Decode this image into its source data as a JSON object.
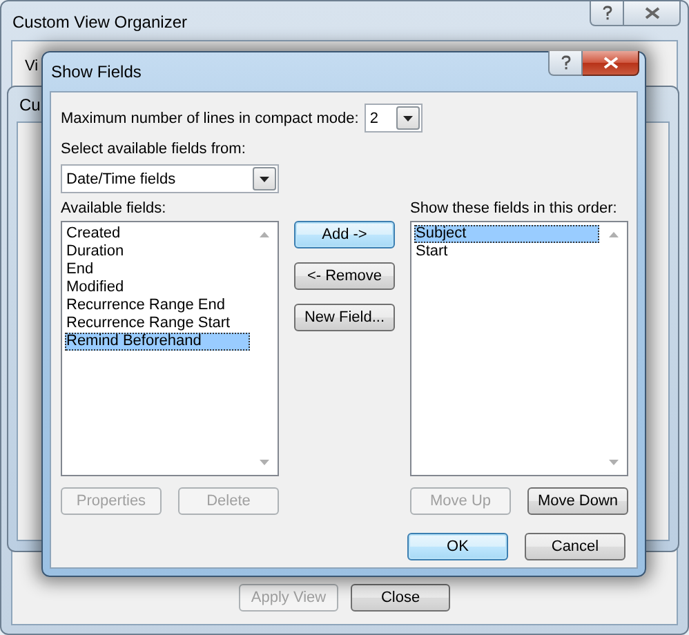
{
  "background_window": {
    "title": "Custom View Organizer",
    "tab_fragment": "Vi",
    "buttons": [
      {
        "label": "Apply View",
        "disabled": true
      },
      {
        "label": "Close",
        "disabled": false
      }
    ]
  },
  "middle_window": {
    "title_fragment": "Cu"
  },
  "dialog": {
    "title": "Show Fields",
    "max_lines": {
      "label": "Maximum number of lines in compact mode:",
      "value": "2"
    },
    "source": {
      "label": "Select available fields from:",
      "value": "Date/Time fields"
    },
    "available": {
      "label": "Available fields:",
      "items": [
        {
          "text": "Created",
          "selected": false
        },
        {
          "text": "Duration",
          "selected": false
        },
        {
          "text": "End",
          "selected": false
        },
        {
          "text": "Modified",
          "selected": false
        },
        {
          "text": "Recurrence Range End",
          "selected": false
        },
        {
          "text": "Recurrence Range Start",
          "selected": false
        },
        {
          "text": "Remind Beforehand",
          "selected": true
        }
      ]
    },
    "shown": {
      "label": "Show these fields in this order:",
      "items": [
        {
          "text": "Subject",
          "selected": true
        },
        {
          "text": "Start",
          "selected": false
        }
      ]
    },
    "middle_buttons": [
      {
        "label": "Add ->",
        "default": true,
        "disabled": false
      },
      {
        "label": "<- Remove",
        "default": false,
        "disabled": false
      },
      {
        "label": "New Field...",
        "default": false,
        "disabled": false
      }
    ],
    "available_buttons": [
      {
        "label": "Properties",
        "default": false,
        "disabled": true
      },
      {
        "label": "Delete",
        "default": false,
        "disabled": true
      }
    ],
    "order_buttons": [
      {
        "label": "Move Up",
        "default": false,
        "disabled": true
      },
      {
        "label": "Move Down",
        "default": false,
        "disabled": false
      }
    ],
    "footer_buttons": [
      {
        "label": "OK",
        "default": true,
        "disabled": false
      },
      {
        "label": "Cancel",
        "default": false,
        "disabled": false
      }
    ]
  }
}
